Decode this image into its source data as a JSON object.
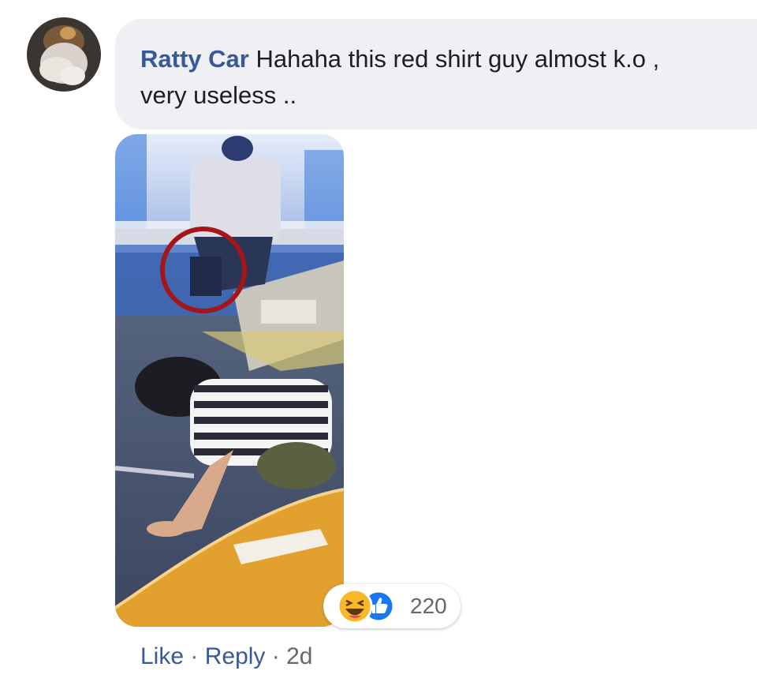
{
  "comment": {
    "author": "Ratty Car",
    "text": "Hahaha this red shirt guy almost k.o ,\nvery useless ..",
    "reactions": {
      "icons": [
        "haha-icon",
        "like-icon"
      ],
      "count": "220"
    },
    "actions": {
      "like_label": "Like",
      "separator": "·",
      "reply_label": "Reply",
      "timestamp": "2d"
    }
  },
  "colors": {
    "bubble_bg": "#eef0f3",
    "author": "#385898",
    "meta": "#65676b",
    "like_blue": "#1877f2",
    "haha_yellow": "#f7b928",
    "highlight_circle": "#a4161a"
  }
}
